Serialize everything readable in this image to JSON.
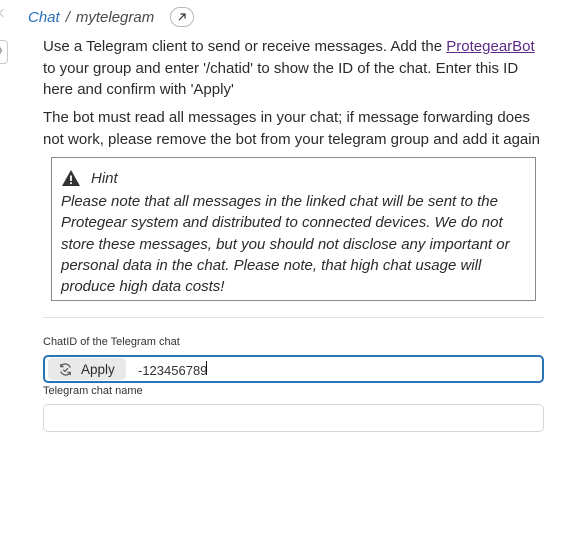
{
  "breadcrumb": {
    "section": "Chat",
    "separator": "/",
    "current": "mytelegram"
  },
  "instructions": {
    "paragraph1_before_link": "Use a Telegram client to send or receive messages. Add the ",
    "bot_link": "ProtegearBot",
    "paragraph1_after_link": " to your group and enter '/chatid' to show the ID of the chat. Enter this ID here and confirm with 'Apply'",
    "paragraph2": "The bot must read all messages in your chat; if message forwarding does not work, please remove the bot from your telegram group and add it again"
  },
  "hint": {
    "title": "Hint",
    "body": "Please note that all messages in the linked chat will be sent to the Protegear system and distributed to connected devices. We do not store these messages, but you should not disclose any important or personal data in the chat. Please note, that high chat usage will produce high data costs!"
  },
  "form": {
    "chat_id_label": "ChatID of the Telegram chat",
    "apply_label": "Apply",
    "chat_id_value": "-123456789",
    "chat_name_label": "Telegram chat name",
    "chat_name_value": ""
  },
  "colors": {
    "link": "#2a6ebb",
    "bot_link": "#5b2a86",
    "focus_border": "#2a73b6"
  },
  "icons": {
    "open": "external-link-icon",
    "warning": "warning-triangle-icon",
    "apply": "refresh-check-icon"
  }
}
